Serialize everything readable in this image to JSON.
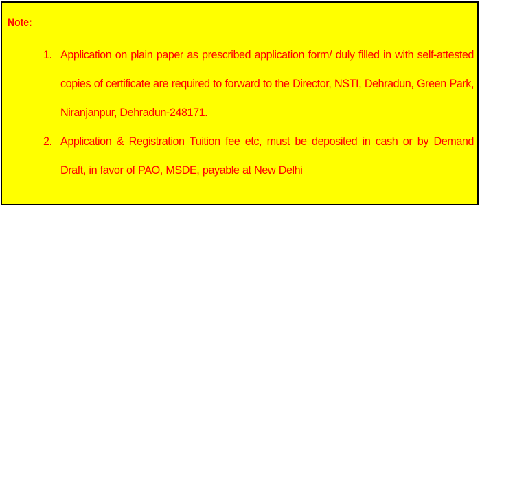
{
  "note": {
    "title": "Note:",
    "items": [
      {
        "number": "1.",
        "text": "Application on plain paper as prescribed application form/ duly filled in with self-attested copies of certificate are required to forward to the Director, NSTI, Dehradun, Green Park, Niranjanpur, Dehradun-248171."
      },
      {
        "number": "2.",
        "text": "Application & Registration Tuition fee etc, must be deposited in cash or by Demand Draft, in favor of PAO, MSDE, payable at New Delhi"
      }
    ]
  },
  "colors": {
    "background": "#ffff00",
    "text": "#ff0000",
    "border": "#000000"
  }
}
